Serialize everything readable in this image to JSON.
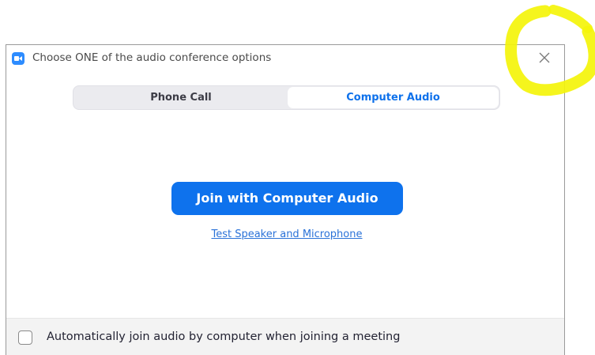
{
  "dialog": {
    "title": "Choose ONE of the audio conference options",
    "app_icon": "zoom-camera-icon",
    "close_icon": "close-icon"
  },
  "tabs": [
    {
      "label": "Phone Call",
      "selected": false
    },
    {
      "label": "Computer Audio",
      "selected": true
    }
  ],
  "main": {
    "join_button_label": "Join with Computer Audio",
    "test_link_label": "Test Speaker and Microphone"
  },
  "footer": {
    "auto_join_label": "Automatically join audio by computer when joining a meeting",
    "auto_join_checked": false
  },
  "colors": {
    "accent": "#0e72ed",
    "highlighter": "#f4f40a"
  }
}
